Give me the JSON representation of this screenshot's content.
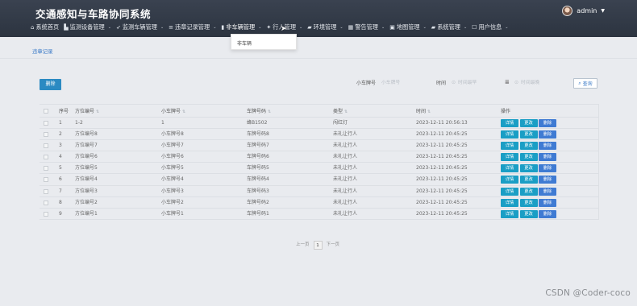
{
  "header": {
    "title": "交通感知与车路协同系统",
    "user_name": "admin"
  },
  "nav": [
    {
      "icon": "⌂",
      "icon_name": "home-icon",
      "label": "系统首页",
      "has_dropdown": false
    },
    {
      "icon": "▙",
      "icon_name": "monitor-icon",
      "label": "监测设备管理",
      "has_dropdown": true
    },
    {
      "icon": "➶",
      "icon_name": "send-icon",
      "label": "监测车辆管理",
      "has_dropdown": true
    },
    {
      "icon": "≡",
      "icon_name": "list-icon",
      "label": "违章记录管理",
      "has_dropdown": true
    },
    {
      "icon": "▮",
      "icon_name": "folder-icon",
      "label": "非车辆管理",
      "has_dropdown": true
    },
    {
      "icon": "✦",
      "icon_name": "person-icon",
      "label": "行人管理",
      "has_dropdown": true
    },
    {
      "icon": "▰",
      "icon_name": "chat-icon",
      "label": "环境管理",
      "has_dropdown": true
    },
    {
      "icon": "▦",
      "icon_name": "grid-icon",
      "label": "警告管理",
      "has_dropdown": true
    },
    {
      "icon": "▣",
      "icon_name": "map-icon",
      "label": "地图管理",
      "has_dropdown": true
    },
    {
      "icon": "▰",
      "icon_name": "chat-icon",
      "label": "系统管理",
      "has_dropdown": true
    },
    {
      "icon": "☐",
      "icon_name": "user-card-icon",
      "label": "用户信息",
      "has_dropdown": true
    }
  ],
  "dropdown": {
    "item": "非车辆"
  },
  "breadcrumb": "违章记录",
  "toolbar": {
    "delete_label": "删除",
    "plate_label": "小车牌号",
    "plate_placeholder": "小车牌号",
    "time_label": "时间",
    "start_placeholder": "时间最早",
    "end_placeholder": "时间最晚",
    "search_label": "查询"
  },
  "table": {
    "headers": {
      "index": "序号",
      "position": "方位编号",
      "car_no": "小车牌号",
      "plate": "车牌号码",
      "type": "类型",
      "time": "时间",
      "ops": "操作"
    },
    "op_labels": {
      "detail": "详情",
      "edit": "更改",
      "delete": "删除"
    },
    "rows": [
      {
        "index": "1",
        "position": "1-2",
        "car_no": "1",
        "plate": "蜂B1502",
        "type": "闯红灯",
        "time": "2023-12-11 20:56:13"
      },
      {
        "index": "2",
        "position": "方位编号8",
        "car_no": "小车牌号8",
        "plate": "车牌号码8",
        "type": "未礼让行人",
        "time": "2023-12-11 20:45:25"
      },
      {
        "index": "3",
        "position": "方位编号7",
        "car_no": "小车牌号7",
        "plate": "车牌号码7",
        "type": "未礼让行人",
        "time": "2023-12-11 20:45:25"
      },
      {
        "index": "4",
        "position": "方位编号6",
        "car_no": "小车牌号6",
        "plate": "车牌号码6",
        "type": "未礼让行人",
        "time": "2023-12-11 20:45:25"
      },
      {
        "index": "5",
        "position": "方位编号5",
        "car_no": "小车牌号5",
        "plate": "车牌号码5",
        "type": "未礼让行人",
        "time": "2023-12-11 20:45:25"
      },
      {
        "index": "6",
        "position": "方位编号4",
        "car_no": "小车牌号4",
        "plate": "车牌号码4",
        "type": "未礼让行人",
        "time": "2023-12-11 20:45:25"
      },
      {
        "index": "7",
        "position": "方位编号3",
        "car_no": "小车牌号3",
        "plate": "车牌号码3",
        "type": "未礼让行人",
        "time": "2023-12-11 20:45:25"
      },
      {
        "index": "8",
        "position": "方位编号2",
        "car_no": "小车牌号2",
        "plate": "车牌号码2",
        "type": "未礼让行人",
        "time": "2023-12-11 20:45:25"
      },
      {
        "index": "9",
        "position": "方位编号1",
        "car_no": "小车牌号1",
        "plate": "车牌号码1",
        "type": "未礼让行人",
        "time": "2023-12-11 20:45:25"
      }
    ]
  },
  "pagination": {
    "prev": "上一页",
    "current": "1",
    "next": "下一页"
  },
  "watermark": "CSDN @Coder-coco"
}
